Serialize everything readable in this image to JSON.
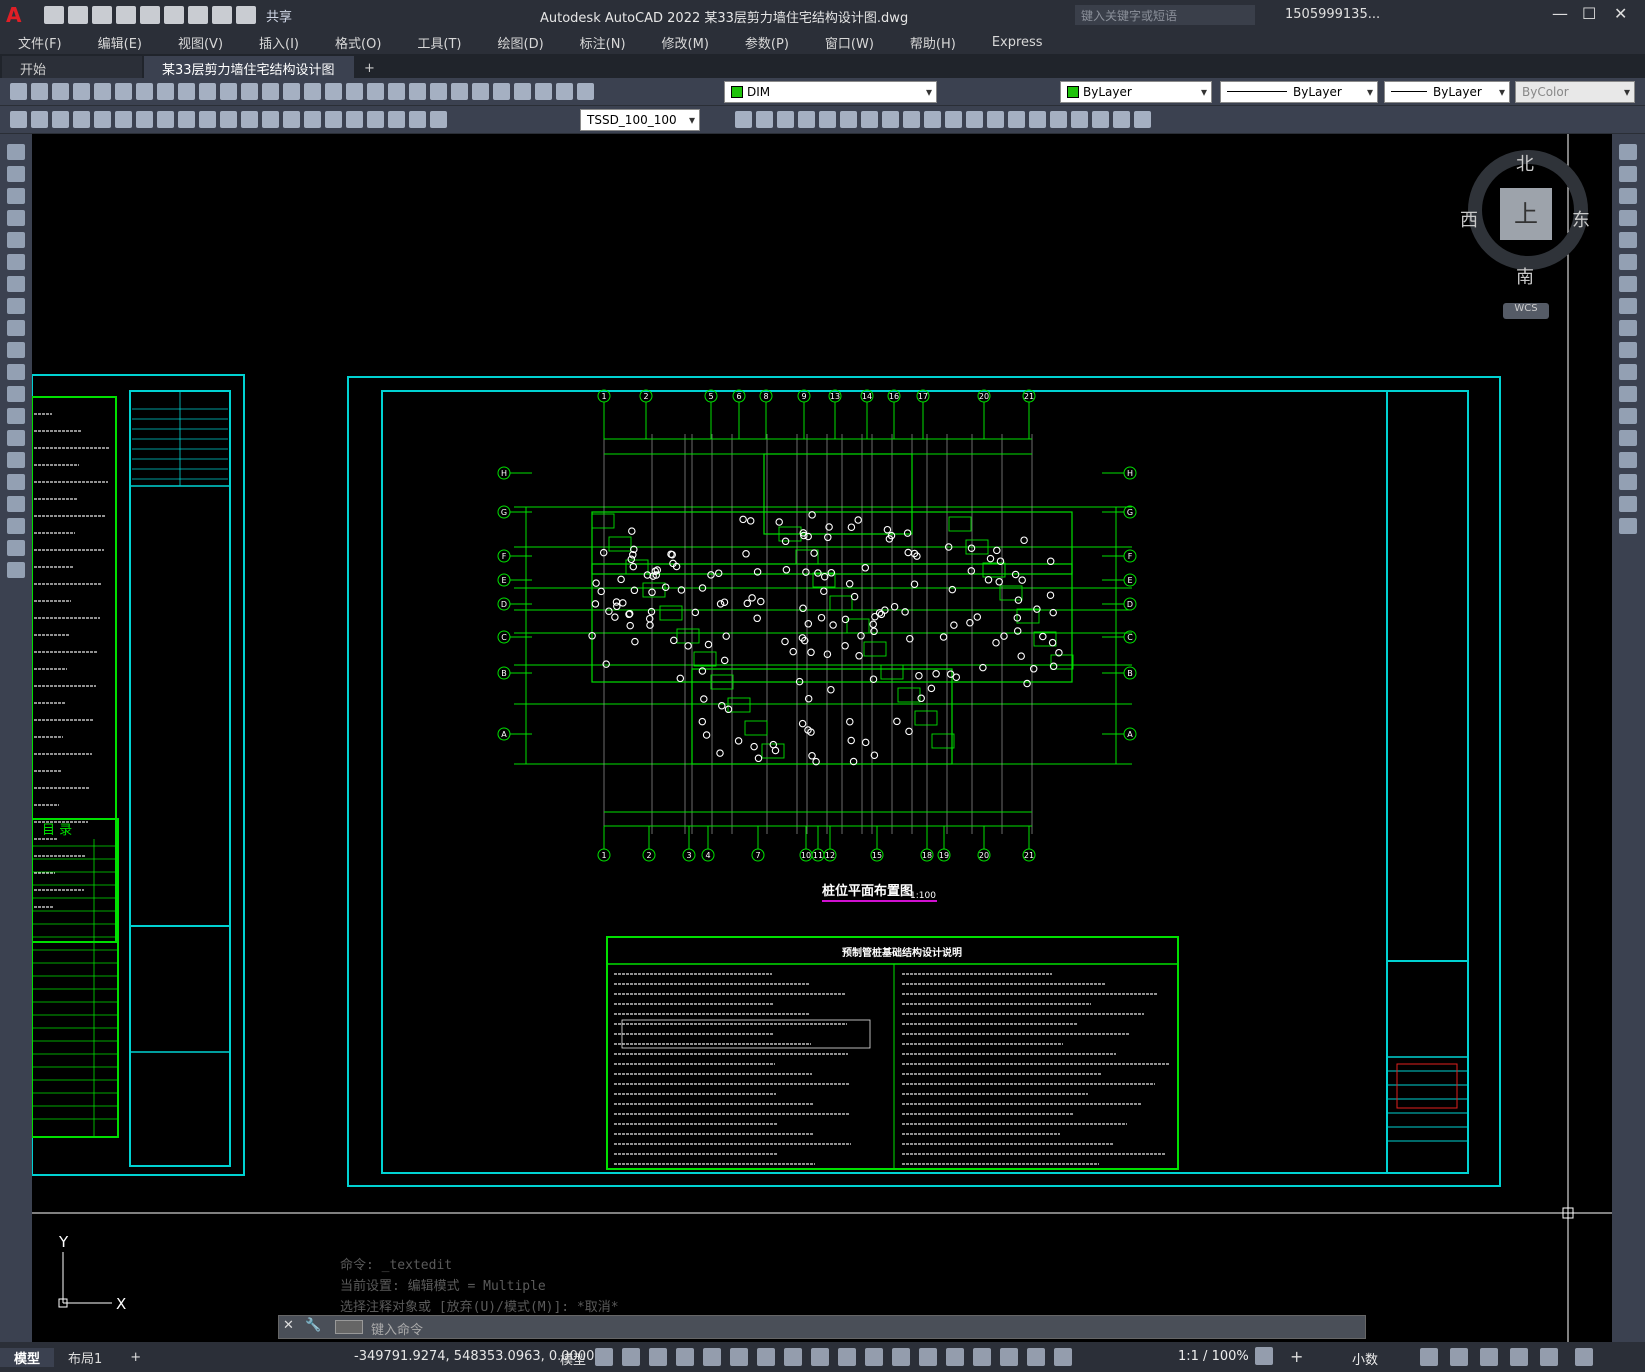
{
  "app": {
    "title": "Autodesk AutoCAD 2022    某33层剪力墙住宅结构设计图.dwg",
    "share_label": "共享",
    "search_placeholder": "键入关键字或短语",
    "user": "1505999135...",
    "logo": "A"
  },
  "menu": [
    "文件(F)",
    "编辑(E)",
    "视图(V)",
    "插入(I)",
    "格式(O)",
    "工具(T)",
    "绘图(D)",
    "标注(N)",
    "修改(M)",
    "参数(P)",
    "窗口(W)",
    "帮助(H)",
    "Express"
  ],
  "tabs": {
    "start": "开始",
    "file": "某33层剪力墙住宅结构设计图*",
    "add": "+"
  },
  "toolbar": {
    "layer": "DIM",
    "color": "ByLayer",
    "linetype": "ByLayer",
    "lineweight": "ByLayer",
    "plotstyle": "ByColor",
    "dimstyle": "TSSD_100_100"
  },
  "viewcube": {
    "north": "北",
    "south": "南",
    "east": "东",
    "west": "西",
    "top": "上",
    "wcs": "WCS"
  },
  "drawing": {
    "title": "桩位平面布置图",
    "scale": "1:100",
    "notes_title": "预制管桩基础结构设计说明",
    "axes_top": [
      "1",
      "2",
      "5",
      "6",
      "8",
      "9",
      "13",
      "14",
      "16",
      "17",
      "20",
      "21"
    ],
    "axes_bottom": [
      "1",
      "2",
      "3",
      "4",
      "7",
      "10",
      "11",
      "12",
      "15",
      "18",
      "19",
      "20",
      "21"
    ],
    "axes_side": [
      "H",
      "G",
      "F",
      "E",
      "D",
      "C",
      "B",
      "A"
    ],
    "list_title": "目 录"
  },
  "ucs": {
    "y": "Y",
    "x": "X"
  },
  "command": {
    "history": [
      "命令: _textedit",
      "当前设置: 编辑模式 = Multiple",
      "选择注释对象或 [放弃(U)/模式(M)]: *取消*"
    ],
    "placeholder": "键入命令"
  },
  "layouts": {
    "model": "模型",
    "layout1": "布局1",
    "add": "+"
  },
  "status": {
    "coords": "-349791.9274, 548353.0963, 0.0000",
    "model": "模型",
    "scale": "1:1 / 100%",
    "units": "小数"
  },
  "colors": {
    "frame": "#00d2d2",
    "grid": "#00e000",
    "bg": "#000000",
    "accent": "#1fc30b"
  }
}
